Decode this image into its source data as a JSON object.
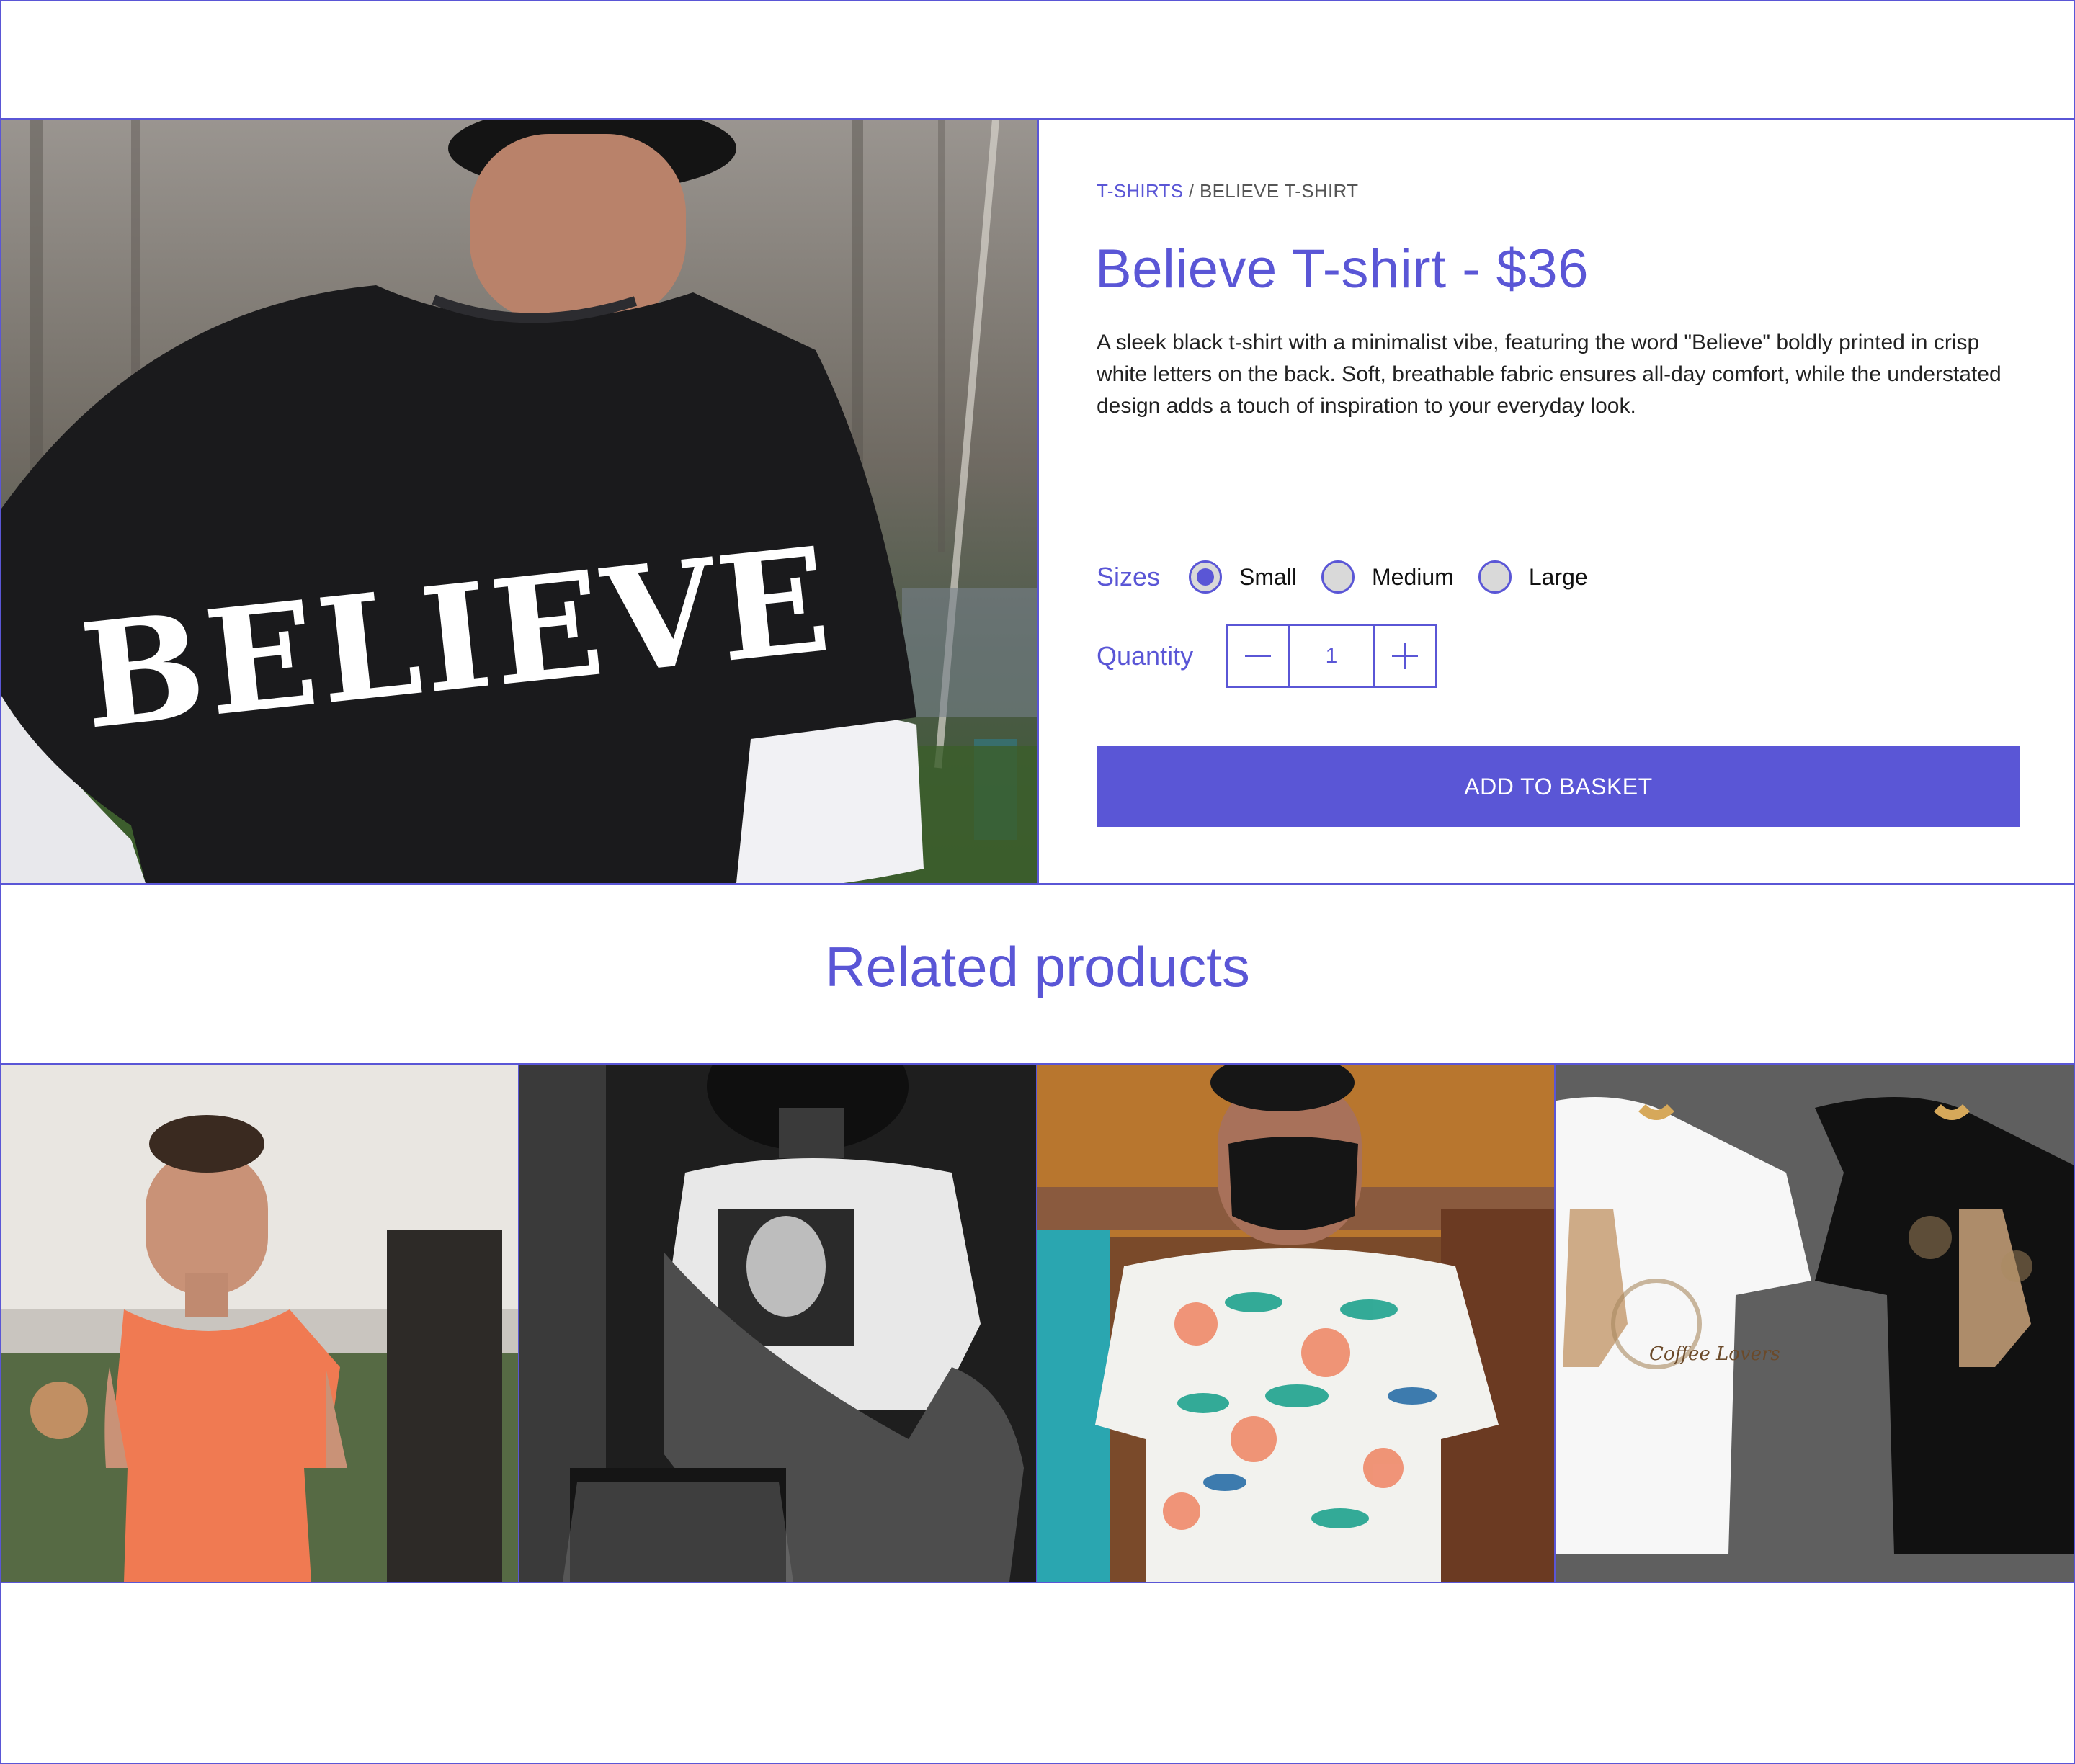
{
  "breadcrumb": {
    "category": "T-SHIRTS",
    "separator": " / ",
    "current": "BELIEVE T-SHIRT"
  },
  "product": {
    "title": "Believe T-shirt - $36",
    "description": "A sleek black t-shirt with a minimalist vibe, featuring the word \"Believe\" boldly printed in crisp white letters on the back. Soft, breathable fabric ensures all-day comfort, while the understated design adds a touch of inspiration to your everyday look.",
    "shirt_print": "BELIEVE"
  },
  "options": {
    "sizes_label": "Sizes",
    "sizes": [
      {
        "label": "Small",
        "selected": true
      },
      {
        "label": "Medium",
        "selected": false
      },
      {
        "label": "Large",
        "selected": false
      }
    ],
    "quantity_label": "Quantity",
    "quantity": "1"
  },
  "actions": {
    "add_to_basket": "ADD TO BASKET"
  },
  "related": {
    "title": "Related products",
    "items": [
      {
        "name": "orange-tshirt"
      },
      {
        "name": "portrait-print-tshirt"
      },
      {
        "name": "floral-tshirt"
      },
      {
        "name": "coffee-lovers-tshirts",
        "print_text": "Coffee Lovers"
      }
    ]
  },
  "colors": {
    "accent": "#5a56d6",
    "text": "#222222",
    "radio_unselected": "#d9d9d9"
  }
}
